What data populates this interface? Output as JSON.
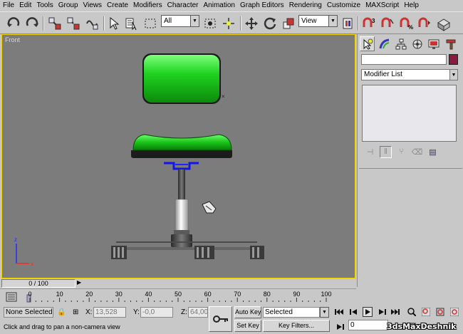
{
  "menu": [
    "File",
    "Edit",
    "Tools",
    "Group",
    "Views",
    "Create",
    "Modifiers",
    "Character",
    "Animation",
    "Graph Editors",
    "Rendering",
    "Customize",
    "MAXScript",
    "Help"
  ],
  "toolbar": {
    "selection_filter": "All",
    "reference_coord": "View"
  },
  "viewport": {
    "label": "Front",
    "background": "#7c7c7c",
    "active_border": "#f2d200",
    "object_color": "#22cc22"
  },
  "command_panel": {
    "modifier_list": "Modifier List",
    "object_color": "#8a1a3e"
  },
  "time": {
    "slider": "0 / 100",
    "ticks": [
      "0",
      "10",
      "20",
      "30",
      "40",
      "50",
      "60",
      "70",
      "80",
      "90",
      "100"
    ]
  },
  "status": {
    "selection": "None Selected",
    "x_label": "X:",
    "x_value": "13,528",
    "y_label": "Y:",
    "y_value": "-0,0",
    "z_label": "Z:",
    "z_value": "64,005",
    "auto_key": "Auto Key",
    "key_mode": "Selected",
    "set_key": "Set Key",
    "key_filters": "Key Filters...",
    "frame": "0",
    "prompt": "Click and drag to pan a non-camera view"
  },
  "watermark": "3dsMaxDeshnik"
}
